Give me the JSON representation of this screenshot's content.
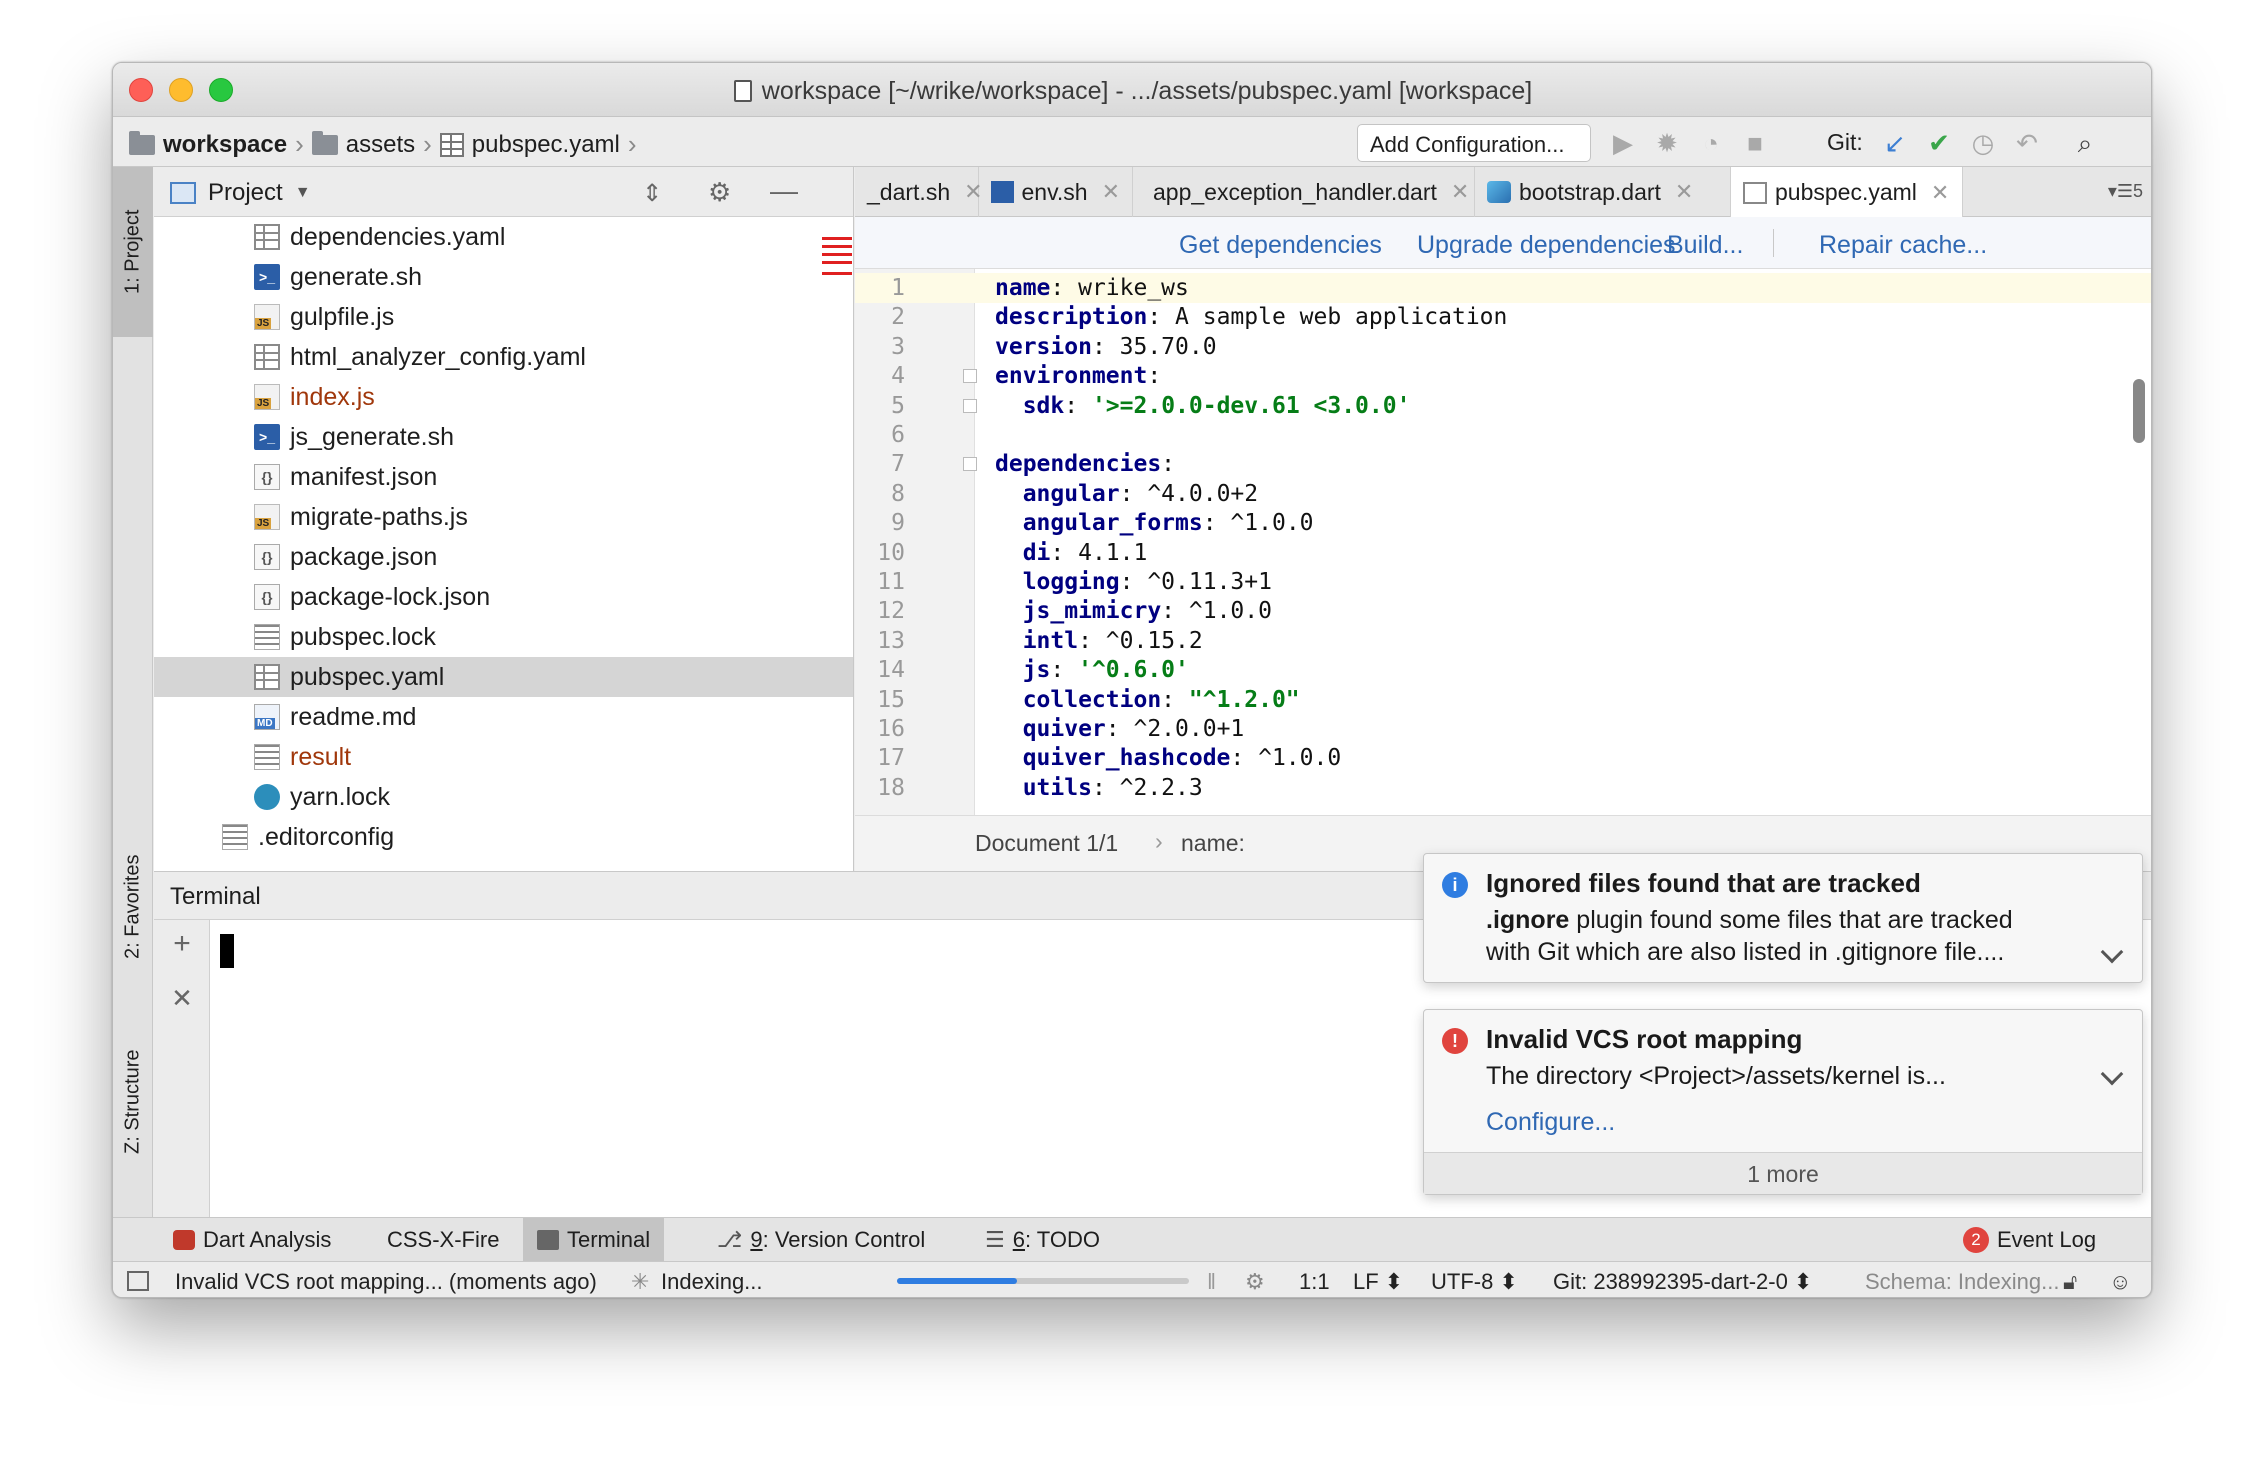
{
  "window": {
    "title": "workspace [~/wrike/workspace] - .../assets/pubspec.yaml [workspace]",
    "traffic_lights": {
      "close": "#fe5f57",
      "minimize": "#febc2e",
      "zoom": "#28c840"
    }
  },
  "navbar": {
    "crumbs": [
      "workspace",
      "assets",
      "pubspec.yaml"
    ],
    "add_configuration": "Add Configuration...",
    "git_label": "Git:"
  },
  "side_tabs": {
    "project": "1: Project",
    "favorites": "2: Favorites",
    "structure": "Z: Structure"
  },
  "project": {
    "title": "Project",
    "files": [
      {
        "name": "dependencies.yaml",
        "icon": "yaml",
        "color": "#1e1e1e"
      },
      {
        "name": "generate.sh",
        "icon": "sh",
        "color": "#1e1e1e"
      },
      {
        "name": "gulpfile.js",
        "icon": "js",
        "color": "#1e1e1e"
      },
      {
        "name": "html_analyzer_config.yaml",
        "icon": "yaml",
        "color": "#1e1e1e"
      },
      {
        "name": "index.js",
        "icon": "js",
        "color": "#a0370b"
      },
      {
        "name": "js_generate.sh",
        "icon": "sh",
        "color": "#1e1e1e"
      },
      {
        "name": "manifest.json",
        "icon": "json",
        "color": "#1e1e1e"
      },
      {
        "name": "migrate-paths.js",
        "icon": "js",
        "color": "#1e1e1e"
      },
      {
        "name": "package.json",
        "icon": "json",
        "color": "#1e1e1e"
      },
      {
        "name": "package-lock.json",
        "icon": "json",
        "color": "#1e1e1e"
      },
      {
        "name": "pubspec.lock",
        "icon": "lock",
        "color": "#1e1e1e"
      },
      {
        "name": "pubspec.yaml",
        "icon": "yaml",
        "color": "#1e1e1e"
      },
      {
        "name": "readme.md",
        "icon": "md",
        "color": "#1e1e1e"
      },
      {
        "name": "result",
        "icon": "lock",
        "color": "#a0370b"
      },
      {
        "name": "yarn.lock",
        "icon": "yarn",
        "color": "#1e1e1e"
      },
      {
        "name": ".editorconfig",
        "icon": "lock",
        "color": "#1e1e1e"
      }
    ],
    "selected": "pubspec.yaml"
  },
  "editor": {
    "tabs": [
      {
        "label": "_dart.sh"
      },
      {
        "label": "env.sh"
      },
      {
        "label": "app_exception_handler.dart"
      },
      {
        "label": "bootstrap.dart"
      },
      {
        "label": "pubspec.yaml"
      }
    ],
    "tab_overflow": "5",
    "active_tab": "pubspec.yaml",
    "pub_actions": [
      "Get dependencies",
      "Upgrade dependencies",
      "Build...",
      "Repair cache..."
    ],
    "lines": [
      {
        "n": "1",
        "key": "name",
        "val": " wrike_ws",
        "str": false
      },
      {
        "n": "2",
        "key": "description",
        "val": " A sample web application",
        "str": false
      },
      {
        "n": "3",
        "key": "version",
        "val": " 35.70.0",
        "str": false
      },
      {
        "n": "4",
        "key": "environment",
        "val": "",
        "str": false
      },
      {
        "n": "5",
        "key": "  sdk",
        "val": " '>=2.0.0-dev.61 <3.0.0'",
        "str": true
      },
      {
        "n": "6",
        "key": "",
        "val": "",
        "str": false
      },
      {
        "n": "7",
        "key": "dependencies",
        "val": "",
        "str": false
      },
      {
        "n": "8",
        "key": "  angular",
        "val": " ^4.0.0+2",
        "str": false
      },
      {
        "n": "9",
        "key": "  angular_forms",
        "val": " ^1.0.0",
        "str": false
      },
      {
        "n": "10",
        "key": "  di",
        "val": " 4.1.1",
        "str": false
      },
      {
        "n": "11",
        "key": "  logging",
        "val": " ^0.11.3+1",
        "str": false
      },
      {
        "n": "12",
        "key": "  js_mimicry",
        "val": " ^1.0.0",
        "str": false
      },
      {
        "n": "13",
        "key": "  intl",
        "val": " ^0.15.2",
        "str": false
      },
      {
        "n": "14",
        "key": "  js",
        "val": " '^0.6.0'",
        "str": true
      },
      {
        "n": "15",
        "key": "  collection",
        "val": " \"^1.2.0\"",
        "str": true
      },
      {
        "n": "16",
        "key": "  quiver",
        "val": " ^2.0.0+1",
        "str": false
      },
      {
        "n": "17",
        "key": "  quiver_hashcode",
        "val": " ^1.0.0",
        "str": false
      },
      {
        "n": "18",
        "key": "  utils",
        "val": " ^2.2.3",
        "str": false
      }
    ],
    "breadcrumb": {
      "doc": "Document 1/1",
      "path": "name:"
    }
  },
  "terminal": {
    "title": "Terminal"
  },
  "notifications": [
    {
      "type": "info",
      "title": "Ignored files found that are tracked",
      "line1_bold": ".ignore",
      "line1_rest": " plugin found some files that are tracked",
      "line2": "with Git which are also listed in .gitignore file...."
    },
    {
      "type": "error",
      "title": "Invalid VCS root mapping",
      "line1": "The directory <Project>/assets/kernel is...",
      "link": "Configure...",
      "more": "1 more"
    }
  ],
  "bottom_tools": {
    "dart_analysis": "Dart Analysis",
    "css_x_fire": "CSS-X-Fire",
    "terminal": "Terminal",
    "version_control_key": "9",
    "version_control": ": Version Control",
    "todo_key": "6",
    "todo": ": TODO",
    "event_log": "Event Log",
    "event_log_count": "2"
  },
  "status": {
    "message": "Invalid VCS root mapping... (moments ago)",
    "indexing": "Indexing...",
    "progress": 0.41,
    "position": "1:1",
    "line_sep": "LF",
    "encoding": "UTF-8",
    "branch": "Git: 238992395-dart-2-0",
    "schema": "Schema: Indexing..."
  },
  "colors": {
    "accent": "#2f68b3",
    "error": "#e02020",
    "info": "#2f7de1"
  }
}
